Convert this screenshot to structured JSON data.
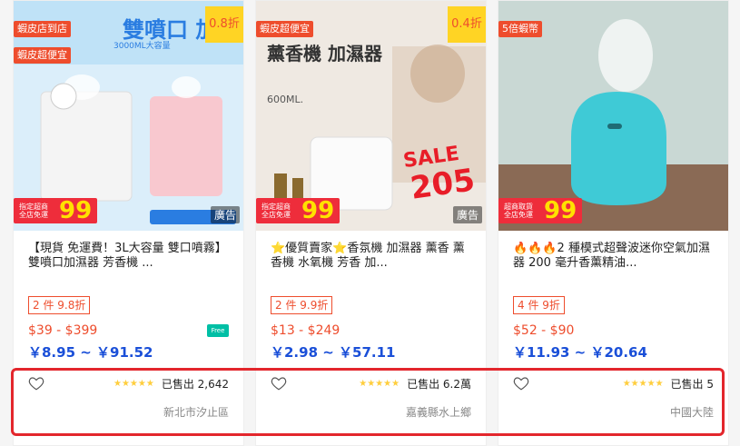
{
  "products": [
    {
      "badges": [
        "蝦皮店到店",
        "蝦皮超便宜"
      ],
      "discount": "0.8折",
      "image_text": {
        "headline": "雙噴口 加濕",
        "capacity": "3000ML大容量",
        "promo_small": "指定超商 全店免運",
        "promo_big": "99"
      },
      "ad_label": "廣告",
      "title": "【現貨 免運費！3L大容量 雙口噴霧】雙噴口加濕器 芳香機 ...",
      "deal": "2 件 9.8折",
      "price": "$39 - $399",
      "free_ship_label": "Free",
      "converted_price": "￥8.95 ~ ￥91.52",
      "stars": "★★★★★",
      "sold": "已售出 2,642",
      "location": "新北市汐止區"
    },
    {
      "badges": [
        "蝦皮超便宜"
      ],
      "discount": "0.4折",
      "image_text": {
        "headline": "薰香機 加濕器",
        "sub": "600ML.",
        "sale": "SALE",
        "sale_price": "205",
        "promo_small": "指定超商 全店免運",
        "promo_big": "99"
      },
      "ad_label": "廣告",
      "title": "⭐優質賣家⭐香氛機 加濕器 薰香 薰香機 水氧機 芳香 加...",
      "deal": "2 件 9.9折",
      "price": "$13 - $249",
      "converted_price": "￥2.98 ~ ￥57.11",
      "stars": "★★★★★",
      "sold": "已售出 6.2萬",
      "location": "嘉義縣水上鄉"
    },
    {
      "badges": [
        "5倍蝦幣"
      ],
      "image_text": {
        "promo_small": "超商取貨 全店免運",
        "promo_big": "99"
      },
      "title": "🔥🔥🔥2 種模式超聲波迷你空氣加濕器 200 毫升香薰精油...",
      "deal": "4 件 9折",
      "price": "$52 - $90",
      "converted_price": "￥11.93 ~ ￥20.64",
      "stars": "★★★★★",
      "sold": "已售出 5",
      "location": "中國大陸"
    }
  ],
  "colors": {
    "accent": "#ee4d2d",
    "converted": "#1a4fd8",
    "highlight": "#e3262c",
    "star": "#ffce3d"
  }
}
